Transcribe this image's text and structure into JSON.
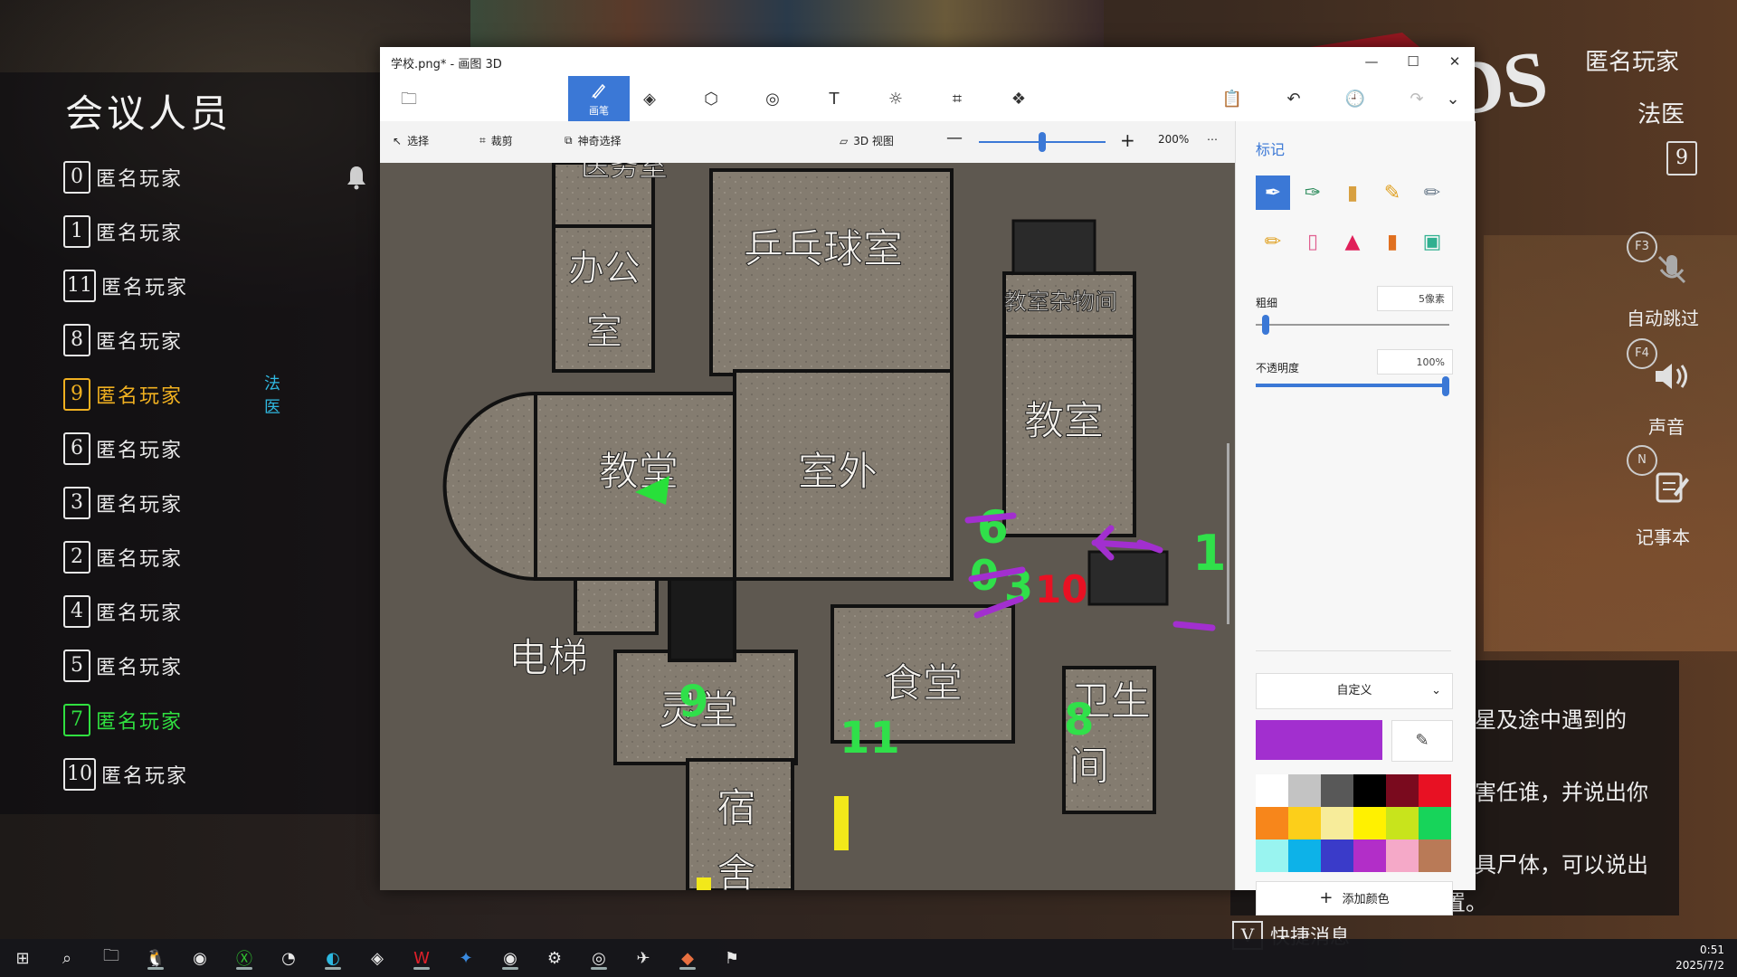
{
  "left_panel": {
    "title": "会议人员",
    "players": [
      {
        "num": "0",
        "name": "匿名玩家",
        "color": "#e8e8e8",
        "tag": ""
      },
      {
        "num": "1",
        "name": "匿名玩家",
        "color": "#e8e8e8",
        "tag": ""
      },
      {
        "num": "11",
        "name": "匿名玩家",
        "color": "#e8e8e8",
        "tag": ""
      },
      {
        "num": "8",
        "name": "匿名玩家",
        "color": "#e8e8e8",
        "tag": ""
      },
      {
        "num": "9",
        "name": "匿名玩家",
        "color": "#f0b020",
        "tag": "法医"
      },
      {
        "num": "6",
        "name": "匿名玩家",
        "color": "#e8e8e8",
        "tag": ""
      },
      {
        "num": "3",
        "name": "匿名玩家",
        "color": "#e8e8e8",
        "tag": ""
      },
      {
        "num": "2",
        "name": "匿名玩家",
        "color": "#e8e8e8",
        "tag": ""
      },
      {
        "num": "4",
        "name": "匿名玩家",
        "color": "#e8e8e8",
        "tag": ""
      },
      {
        "num": "5",
        "name": "匿名玩家",
        "color": "#e8e8e8",
        "tag": ""
      },
      {
        "num": "7",
        "name": "匿名玩家",
        "color": "#30e040",
        "tag": ""
      },
      {
        "num": "10",
        "name": "匿名玩家",
        "color": "#e8e8e8",
        "tag": ""
      }
    ]
  },
  "hud_right": {
    "player_name": "匿名玩家",
    "role": "法医",
    "player_num": "9",
    "logo_text": "OUNDS",
    "controls": [
      {
        "key": "F3",
        "label": "自动跳过",
        "icon": "mic-muted-icon"
      },
      {
        "key": "F4",
        "label": "声音",
        "icon": "speaker-icon"
      },
      {
        "key": "N",
        "label": "记事本",
        "icon": "notepad-icon"
      }
    ]
  },
  "chat": {
    "lines": [
      "星及途中遇到的",
      "害任谁，并说出你",
      "具尸体，可以说出",
      "他们的具体位置。"
    ],
    "bottom_key": "V",
    "bottom_text": "快捷消息"
  },
  "paint3d": {
    "title": "学校.png* - 画图 3D",
    "active_tool_label": "画笔",
    "toolbar_icons": [
      "folder-icon",
      "brush-icon",
      "2d-shapes-icon",
      "3d-shapes-icon",
      "stickers-icon",
      "text-icon",
      "effects-icon",
      "canvas-icon",
      "3d-library-icon",
      "paste-icon",
      "undo-icon",
      "history-icon",
      "redo-icon",
      "expand-icon"
    ],
    "subbar": {
      "select": "选择",
      "crop": "裁剪",
      "magic_select": "神奇选择",
      "view3d": "3D 视图",
      "zoom": "200%",
      "zoom_level": 0.5
    },
    "right_panel": {
      "title": "标记",
      "thickness_label": "粗细",
      "thickness_value": "5像素",
      "thickness_level": 0.05,
      "opacity_label": "不透明度",
      "opacity_value": "100%",
      "opacity_level": 1.0,
      "color_mode": "自定义",
      "current_color": "#a22fcf",
      "add_color": "添加颜色",
      "palette": [
        "#ffffff",
        "#c3c3c3",
        "#585858",
        "#000000",
        "#7a0a1e",
        "#e81123",
        "#f7861b",
        "#fccf1a",
        "#f7ec9a",
        "#fff100",
        "#c8e41c",
        "#17d45a",
        "#99f4f0",
        "#0db2e8",
        "#3a3bc9",
        "#b22ec8",
        "#f5a9c8",
        "#b97a57"
      ]
    },
    "map_labels": {
      "clinic": "医务室",
      "office_1": "办公",
      "office_2": "室",
      "pingpong": "乒乓球室",
      "storage": "教室杂物间",
      "classroom": "教室",
      "church": "教堂",
      "outdoor": "室外",
      "elevator": "电梯",
      "spirit_hall": "灵堂",
      "canteen": "食堂",
      "toilet_1": "卫生",
      "toilet_2": "间",
      "dorm_1": "宿",
      "dorm_2": "舍"
    },
    "annotations": [
      "6",
      "0",
      "3",
      "10",
      "1",
      "9",
      "11",
      "8"
    ]
  },
  "taskbar": {
    "time": "0:51",
    "date": "2025/7/2",
    "apps": [
      "windows-icon",
      "search-icon",
      "file-explorer-icon",
      "qq-icon",
      "qq-browser-icon",
      "xbox-icon",
      "speedtest-icon",
      "edge-icon",
      "microsoft365-icon",
      "wps-icon",
      "feishu-icon",
      "qq-browser2-icon",
      "steam-icon",
      "app-circle-icon",
      "game-launcher-icon",
      "paint3d-icon",
      "game-icon"
    ]
  }
}
